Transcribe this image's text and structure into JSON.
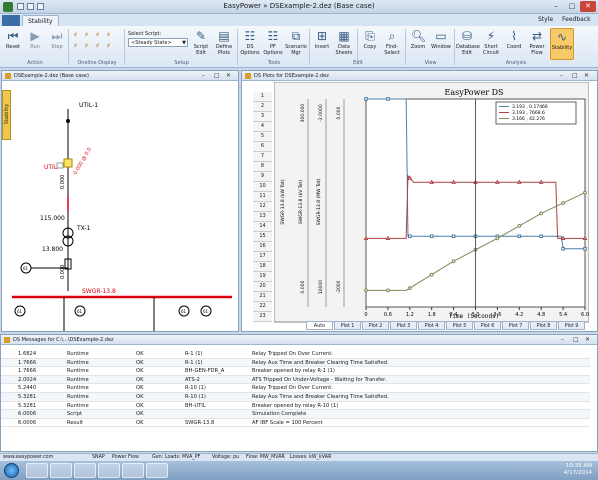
{
  "window": {
    "title": "EasyPower » DSExample-2.dez  (Base case)"
  },
  "tabs": {
    "active": "Stability",
    "style": "Style",
    "feedback": "Feedback"
  },
  "ribbon": {
    "buttons": [
      {
        "label": "Reset",
        "icon": "reset-icon"
      },
      {
        "label": "Run",
        "icon": "play-icon"
      },
      {
        "label": "Step",
        "icon": "step-icon"
      },
      {
        "label": "Script Edit",
        "icon": "script-edit-icon"
      },
      {
        "label": "Define Plots",
        "icon": "define-plots-icon"
      },
      {
        "label": "DS Options",
        "icon": "ds-options-icon"
      },
      {
        "label": "PF Options",
        "icon": "pf-options-icon"
      },
      {
        "label": "Scenario Mgr",
        "icon": "scenario-icon"
      },
      {
        "label": "Insert",
        "icon": "insert-icon"
      },
      {
        "label": "Data Sheets",
        "icon": "data-sheets-icon"
      },
      {
        "label": "Copy",
        "icon": "copy-icon"
      },
      {
        "label": "Find-Select",
        "icon": "find-icon"
      },
      {
        "label": "Zoom",
        "icon": "zoom-icon"
      },
      {
        "label": "Window",
        "icon": "window-icon"
      },
      {
        "label": "Database Edit",
        "icon": "database-icon"
      },
      {
        "label": "Short Circuit",
        "icon": "short-circuit-icon"
      },
      {
        "label": "Coord",
        "icon": "coord-icon"
      },
      {
        "label": "Power Flow",
        "icon": "power-flow-icon"
      },
      {
        "label": "Stability",
        "icon": "stability-icon"
      }
    ],
    "groups": [
      "Action",
      "Oneline Display",
      "Setup",
      "Tools",
      "Edit",
      "View",
      "Analysis"
    ],
    "script_label": "Select Script:",
    "script_value": "<Steady State>"
  },
  "left_panel": {
    "title": "DSExample-2.dez  (Base case)",
    "side_tab": "Stability",
    "labels": {
      "util1": "UTIL-1",
      "util": "UTIL",
      "util_res": "0.000 @ 0.0",
      "util_v": "0.000",
      "kv115": "115.000",
      "tx1": "TX-1",
      "kv13": "13.800",
      "tx_v": "0.000",
      "swgr": "SWGR-13.8",
      "r61a": "61",
      "r61b": "61",
      "r61c": "61",
      "r61d": "61",
      "r61e": "61"
    }
  },
  "plot_panel": {
    "title": "DS Plots for DSExample-2.dez",
    "row_numbers": [
      "1",
      "2",
      "3",
      "4",
      "5",
      "6",
      "7",
      "8",
      "9",
      "10",
      "11",
      "12",
      "13",
      "14",
      "15",
      "16",
      "17",
      "18",
      "19",
      "20",
      "21",
      "22",
      "23"
    ],
    "tabs": [
      "Auto",
      "Plot 1",
      "Plot 2",
      "Plot 3",
      "Plot 4",
      "Plot 5",
      "Plot 6",
      "Plot 7",
      "Plot 8",
      "Plot 9"
    ],
    "axis_labels": [
      "SWGR-13.8 (kW Tot)",
      "SWGR-13.8 (kV Tot)",
      "SWGR-13.8 (MW Tot)"
    ]
  },
  "chart_data": {
    "type": "line",
    "title": "EasyPower DS",
    "xlabel": "Time (Seconds)",
    "x_ticks": [
      "0",
      "0.6",
      "1.2",
      "1.8",
      "2.4",
      "3.0",
      "3.6",
      "4.2",
      "4.8",
      "5.4",
      "6.0"
    ],
    "xlim": [
      0,
      6
    ],
    "y_left_ticks": [
      "300.000",
      "0.000",
      "-2.0000",
      "10000",
      "0.000",
      "-2000"
    ],
    "legend": [
      {
        "marker": "square",
        "value": "3.193 , 0.17466"
      },
      {
        "marker": "triangle",
        "value": "3.193 , 7668.6"
      },
      {
        "marker": "circle",
        "value": "3.166 , 42.276"
      }
    ],
    "cursor_x": 3.0,
    "series": [
      {
        "color": "#4a7fa8",
        "x": [
          0,
          1.1,
          1.15,
          1.2,
          5.35,
          5.4,
          6.0
        ],
        "y": [
          1.0,
          1.0,
          0.34,
          0.34,
          0.34,
          0.28,
          0.28
        ]
      },
      {
        "color": "#b04040",
        "x": [
          0,
          1.1,
          1.15,
          1.3,
          2.0,
          5.2,
          5.25,
          6.0
        ],
        "y": [
          0.33,
          0.33,
          0.63,
          0.6,
          0.6,
          0.6,
          0.33,
          0.33
        ]
      },
      {
        "color": "#7a8a5a",
        "x": [
          0,
          1.1,
          2.4,
          3.6,
          4.8,
          6.0
        ],
        "y": [
          0.08,
          0.08,
          0.22,
          0.33,
          0.45,
          0.55
        ]
      }
    ]
  },
  "messages": {
    "title": "DS Messages for C:\\...\\DSExample-2.dez",
    "rows": [
      [
        "1.6824",
        "Runtime",
        "OK",
        "R-1 (1)",
        "Relay Tripped On Over Current."
      ],
      [
        "1.7666",
        "Runtime",
        "OK",
        "R-1 (1)",
        "Relay Aux Time and Breaker Clearing Time Satisfied."
      ],
      [
        "1.7666",
        "Runtime",
        "OK",
        "BH-GEN-FDR_A",
        "Breaker opened by relay R-1 (1)"
      ],
      [
        "2.0024",
        "Runtime",
        "OK",
        "ATS-2",
        "ATS Tripped On Under-Voltage - Waiting for Transfer."
      ],
      [
        "5.2440",
        "Runtime",
        "OK",
        "R-10 (1)",
        "Relay Tripped On Over Current."
      ],
      [
        "5.3281",
        "Runtime",
        "OK",
        "R-10 (1)",
        "Relay Aux Time and Breaker Clearing Time Satisfied."
      ],
      [
        "5.3281",
        "Runtime",
        "OK",
        "BH-UTIL",
        "Breaker opened by relay R-10 (1)"
      ],
      [
        "6.0006",
        "Script",
        "OK",
        "",
        "Simulation Complete"
      ],
      [
        "6.0006",
        "Result",
        "OK",
        "SWGR-13.8",
        "AF IBF Scale = 100 Percent"
      ]
    ]
  },
  "status": {
    "items": [
      "SNAP",
      "Power Flow",
      "Gen: Loads: MVA_PF",
      "Voltage: pu",
      "Flow: MW_MVAR",
      "Losses: kW_kVAR"
    ],
    "url": "www.easypower.com"
  },
  "clock": {
    "time": "10:35 AM",
    "date": "4/17/2014"
  }
}
